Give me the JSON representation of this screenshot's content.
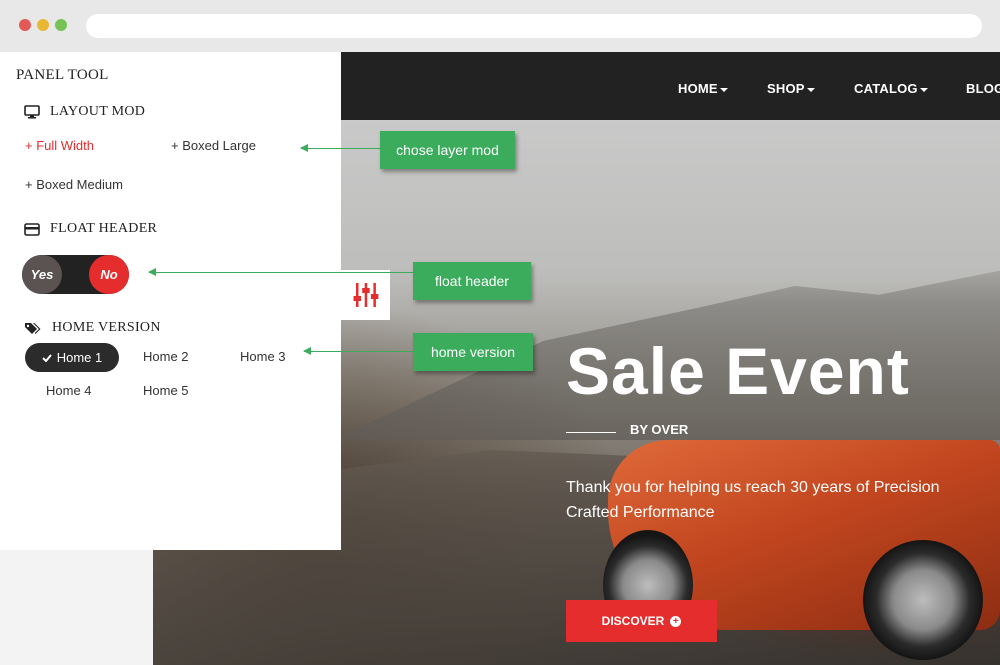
{
  "nav": {
    "items": [
      "HOME",
      "SHOP",
      "CATALOG",
      "BLOG"
    ]
  },
  "hero": {
    "title": "Sale Event",
    "subtitle": "BY OVER",
    "text": "Thank you for helping us reach 30 years of Precision Crafted Performance",
    "button_label": "DISCOVER"
  },
  "panel": {
    "title": "PANEL TOOL",
    "layout": {
      "title": "LAYOUT MOD",
      "options": [
        "+ Full Width",
        "+ Boxed Large",
        "+ Boxed Medium"
      ],
      "active": "+ Full Width"
    },
    "float_header": {
      "title": "FLOAT HEADER",
      "yes_label": "Yes",
      "no_label": "No",
      "selected": "No"
    },
    "home_version": {
      "title": "HOME VERSION",
      "options": [
        "Home 1",
        "Home 2",
        "Home 3",
        "Home 4",
        "Home 5"
      ],
      "active": "Home 1"
    }
  },
  "callouts": {
    "layout": "chose layer mod",
    "float_header": "float header",
    "home_version": "home version"
  },
  "colors": {
    "accent": "#e52d2d",
    "callout": "#3aac5c",
    "nav_bg": "#222222"
  }
}
